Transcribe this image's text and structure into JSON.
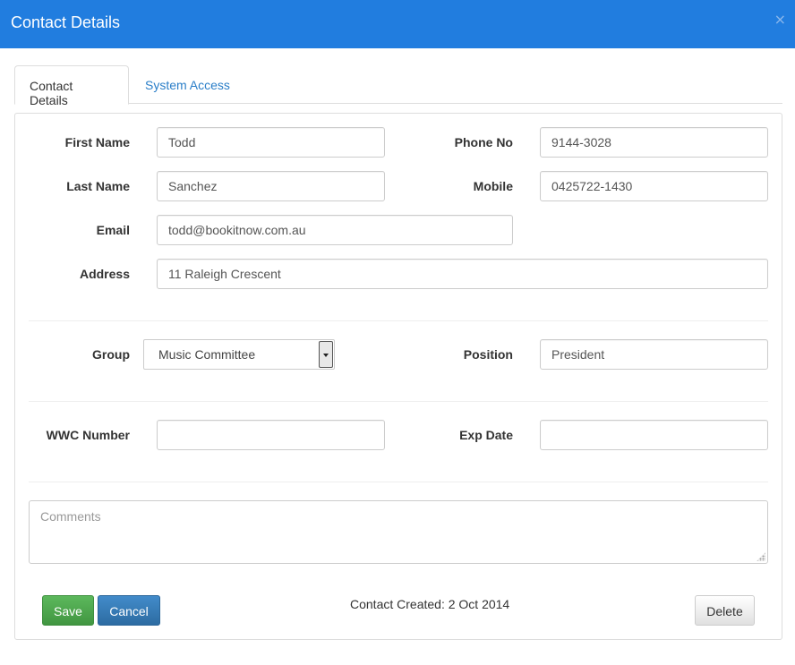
{
  "header": {
    "title": "Contact Details",
    "close_glyph": "×"
  },
  "tabs": [
    {
      "label": "Contact Details",
      "active": true
    },
    {
      "label": "System Access",
      "active": false
    }
  ],
  "form": {
    "first_name": {
      "label": "First Name",
      "value": "Todd"
    },
    "phone_no": {
      "label": "Phone No",
      "value": "9144-3028"
    },
    "last_name": {
      "label": "Last Name",
      "value": "Sanchez"
    },
    "mobile": {
      "label": "Mobile",
      "value": "0425722-1430"
    },
    "email": {
      "label": "Email",
      "value": "todd@bookitnow.com.au"
    },
    "address": {
      "label": "Address",
      "value": "11 Raleigh Crescent"
    },
    "group": {
      "label": "Group",
      "value": "Music Committee"
    },
    "position": {
      "label": "Position",
      "value": "President"
    },
    "wwc_number": {
      "label": "WWC Number",
      "value": ""
    },
    "exp_date": {
      "label": "Exp Date",
      "value": ""
    },
    "comments": {
      "placeholder": "Comments",
      "value": ""
    }
  },
  "footer": {
    "save_label": "Save",
    "cancel_label": "Cancel",
    "delete_label": "Delete",
    "created_text": "Contact Created: 2 Oct 2014"
  },
  "colors": {
    "header": "#217ddf",
    "save": "#5cb85c",
    "cancel": "#428bca",
    "link": "#2a7ec8"
  }
}
